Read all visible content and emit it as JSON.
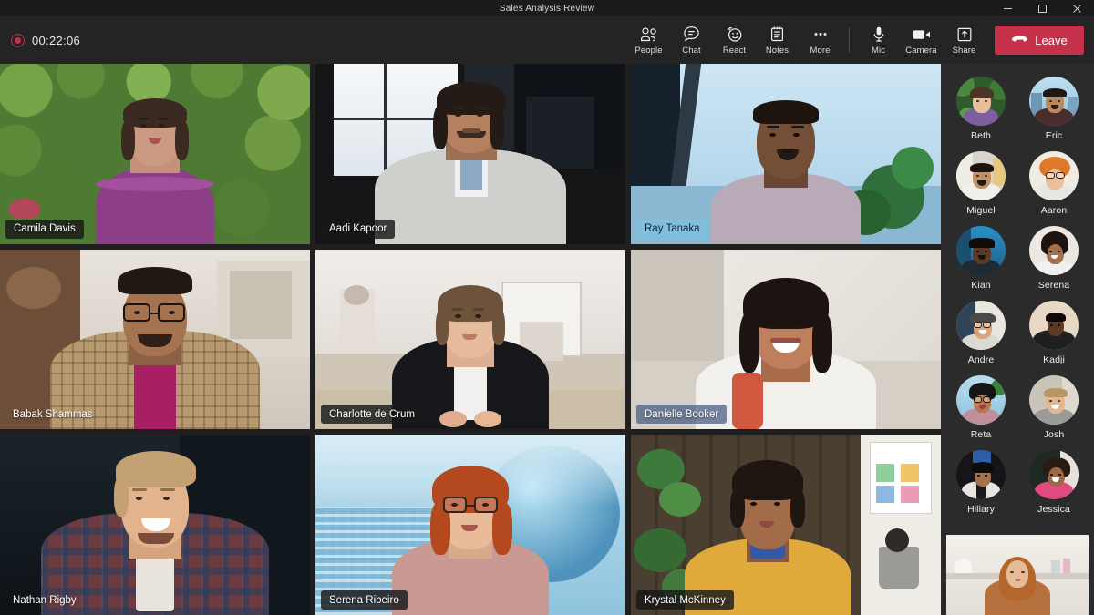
{
  "window": {
    "title": "Sales Analysis Review",
    "controls": [
      {
        "name": "minimize",
        "label": "Minimize"
      },
      {
        "name": "maximize",
        "label": "Maximize"
      },
      {
        "name": "close",
        "label": "Close"
      }
    ]
  },
  "toolbar": {
    "recording": {
      "timer": "00:22:06",
      "icon": "record-icon"
    },
    "actions": [
      {
        "id": "people",
        "label": "People",
        "icon": "people-icon"
      },
      {
        "id": "chat",
        "label": "Chat",
        "icon": "chat-icon"
      },
      {
        "id": "react",
        "label": "React",
        "icon": "react-icon"
      },
      {
        "id": "notes",
        "label": "Notes",
        "icon": "notes-icon"
      },
      {
        "id": "more",
        "label": "More",
        "icon": "more-icon"
      }
    ],
    "device_actions": [
      {
        "id": "mic",
        "label": "Mic",
        "icon": "microphone-icon"
      },
      {
        "id": "camera",
        "label": "Camera",
        "icon": "camera-icon"
      },
      {
        "id": "share",
        "label": "Share",
        "icon": "share-icon"
      }
    ],
    "leave": {
      "label": "Leave",
      "icon": "hangup-icon",
      "color": "#c4314b"
    }
  },
  "stage": {
    "tiles": [
      {
        "name": "Camila Davis",
        "badge_style": "dark"
      },
      {
        "name": "Aadi Kapoor",
        "badge_style": "dark"
      },
      {
        "name": "Ray Tanaka",
        "badge_style": "speaking"
      },
      {
        "name": "Babak Shammas",
        "badge_style": "ghost"
      },
      {
        "name": "Charlotte de Crum",
        "badge_style": "dark"
      },
      {
        "name": "Danielle Booker",
        "badge_style": "tinted"
      },
      {
        "name": "Nathan Rigby",
        "badge_style": "ghost"
      },
      {
        "name": "Serena Ribeiro",
        "badge_style": "dark"
      },
      {
        "name": "Krystal McKinney",
        "badge_style": "dark"
      }
    ]
  },
  "roster": {
    "people": [
      {
        "name": "Beth"
      },
      {
        "name": "Eric"
      },
      {
        "name": "Miguel"
      },
      {
        "name": "Aaron"
      },
      {
        "name": "Kian"
      },
      {
        "name": "Serena"
      },
      {
        "name": "Andre"
      },
      {
        "name": "Kadji"
      },
      {
        "name": "Reta"
      },
      {
        "name": "Josh"
      },
      {
        "name": "Hillary"
      },
      {
        "name": "Jessica"
      }
    ],
    "self_view": {
      "label": ""
    }
  },
  "colors": {
    "app_bg": "#1f1f1f",
    "toolbar_bg": "#242424",
    "roster_bg": "#2b2b2b",
    "leave": "#c4314b",
    "speaking_badge": "#7ebedd"
  }
}
